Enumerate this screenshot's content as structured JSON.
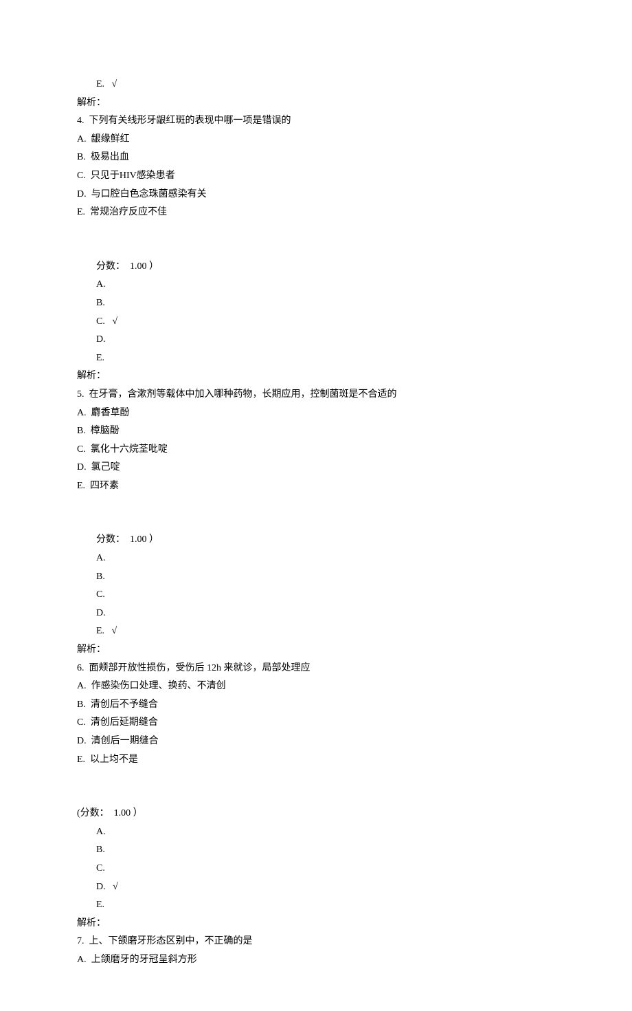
{
  "q3_answers": {
    "E": "E.   √"
  },
  "analysis_label": "解析：",
  "q4": {
    "num": "4.",
    "stem": "下列有关线形牙龈红斑的表现中哪一项是错误的",
    "A": "A.  龈缘鲜红",
    "B": "B.  极易出血",
    "C": "C.  只见于HIV感染患者",
    "D": "D.  与口腔白色念珠菌感染有关",
    "E": "E.  常规治疗反应不佳",
    "score": "分数：  1.00 ）",
    "ansA": "A.",
    "ansB": "B.",
    "ansC": "C.   √",
    "ansD": "D.",
    "ansE": "E."
  },
  "q5": {
    "num": "5.",
    "stem": "在牙膏，含漱剂等载体中加入哪种药物，长期应用，控制菌斑是不合适的",
    "A": "A.  麝香草酚",
    "B": "B.  樟脑酚",
    "C": "C.  氯化十六烷荃吡啶",
    "D": "D.  氯己啶",
    "E": "E.  四环素",
    "score": "分数：  1.00 ）",
    "ansA": "A.",
    "ansB": "B.",
    "ansC": "C.",
    "ansD": "D.",
    "ansE": "E.   √"
  },
  "q6": {
    "num": "6.",
    "stem": "面颊部开放性损伤，受伤后 12h 来就诊，局部处理应",
    "A": "A.  作感染伤口处理、换药、不清创",
    "B": "B.  清创后不予缝合",
    "C": "C.  清创后延期缝合",
    "D": "D.  清创后一期缝合",
    "E": "E.  以上均不是",
    "score": "(分数：  1.00 ）",
    "ansA": "A.",
    "ansB": "B.",
    "ansC": "C.",
    "ansD": "D.   √",
    "ansE": "E."
  },
  "q7": {
    "num": "7.",
    "stem": "上、下颌磨牙形态区别中，不正确的是",
    "A": "A.  上颌磨牙的牙冠呈斜方形"
  }
}
